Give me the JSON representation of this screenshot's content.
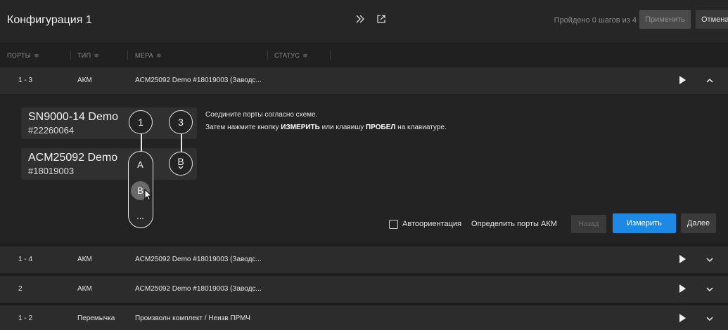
{
  "header": {
    "title": "Конфигурация 1",
    "steps_text": "Пройдено 0 шагов из 4",
    "apply_label": "Применить",
    "cancel_label": "Отмена",
    "icons": [
      "double-chevron-right-icon",
      "external-link-icon"
    ]
  },
  "columns": [
    {
      "label": "ПОРТЫ",
      "sort": "⇕"
    },
    {
      "label": "ТИП",
      "sort": "⇕"
    },
    {
      "label": "МЕРА",
      "sort": "⇕"
    },
    {
      "label": "СТАТУС",
      "sort": "⇕"
    }
  ],
  "rows": [
    {
      "ports": "1 - 3",
      "type": "АКМ",
      "measure": "ACM25092 Demo #18019003 (Заводс...",
      "expanded": true
    },
    {
      "ports": "1 - 4",
      "type": "АКМ",
      "measure": "ACM25092 Demo #18019003 (Заводс...",
      "expanded": false
    },
    {
      "ports": "2",
      "type": "АКМ",
      "measure": "ACM25092 Demo #18019003 (Заводс...",
      "expanded": false
    },
    {
      "ports": "1 - 2",
      "type": "Перемычка",
      "measure": "Произволн комплект / Неизв ПРМЧ",
      "expanded": false
    }
  ],
  "panel": {
    "device1": {
      "name": "SN9000-14 Demo",
      "serial": "#22260064"
    },
    "device2": {
      "name": "ACM25092 Demo",
      "serial": "#18019003"
    },
    "port_top_left": "1",
    "port_top_right": "3",
    "port_list": [
      "A",
      "B",
      "..."
    ],
    "port_selected_right": "B",
    "instruction_line1": "Соедините порты согласно схеме.",
    "instruction_line2_pre": "Затем нажмите кнопку ",
    "instruction_line2_b1": "ИЗМЕРИТЬ",
    "instruction_line2_mid": " или клавишу ",
    "instruction_line2_b2": "ПРОБЕЛ",
    "instruction_line2_post": " на клавиатуре.",
    "auto_orient_label": "Автоориентация",
    "auto_orient_checked": false,
    "detect_ports_label": "Определить порты АКМ",
    "back_label": "Назад",
    "measure_label": "Измерить",
    "next_label": "Далее"
  },
  "colors": {
    "accent": "#1e88e5",
    "row_bg": "#2c2c2c",
    "panel_bg": "#232323"
  }
}
